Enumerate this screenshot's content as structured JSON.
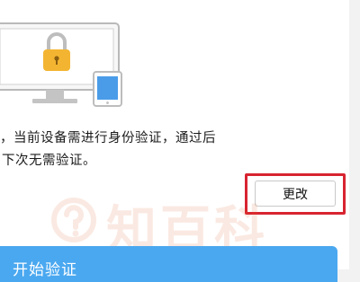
{
  "security_verify": {
    "message_line1": "，当前设备需进行身份验证，通过后",
    "message_line2": "下次无需验证。",
    "change_button_label": "更改",
    "start_button_label": "开始验证"
  },
  "watermark": {
    "text": "知百科"
  },
  "icons": {
    "illustration": "monitor-lock-tablet",
    "watermark_badge": "question-circle"
  },
  "colors": {
    "highlight": "#d82430",
    "start_button": "#4aa8f0",
    "lock": "#f3b531",
    "tablet_screen": "#4a9ce8"
  }
}
